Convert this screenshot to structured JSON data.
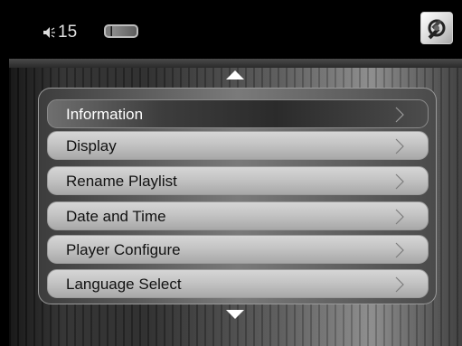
{
  "status": {
    "volume_icon": "speaker-icon",
    "volume_level": "15",
    "battery_icon": "battery-icon",
    "settings_icon": "settings-tools-icon"
  },
  "menu": {
    "scroll_up_icon": "triangle-up-icon",
    "scroll_down_icon": "triangle-down-icon",
    "items": [
      {
        "label": "Information",
        "selected": true
      },
      {
        "label": "Display",
        "selected": false
      },
      {
        "label": "Rename Playlist",
        "selected": false
      },
      {
        "label": "Date and Time",
        "selected": false
      },
      {
        "label": "Player Configure",
        "selected": false
      },
      {
        "label": "Language Select",
        "selected": false
      }
    ],
    "item_chevron_icon": "chevron-right-icon"
  },
  "colors": {
    "background": "#000000",
    "item_normal": "#c8c8c8",
    "item_selected": "#2b2b2b",
    "text_normal": "#111111",
    "text_selected": "#ffffff"
  }
}
